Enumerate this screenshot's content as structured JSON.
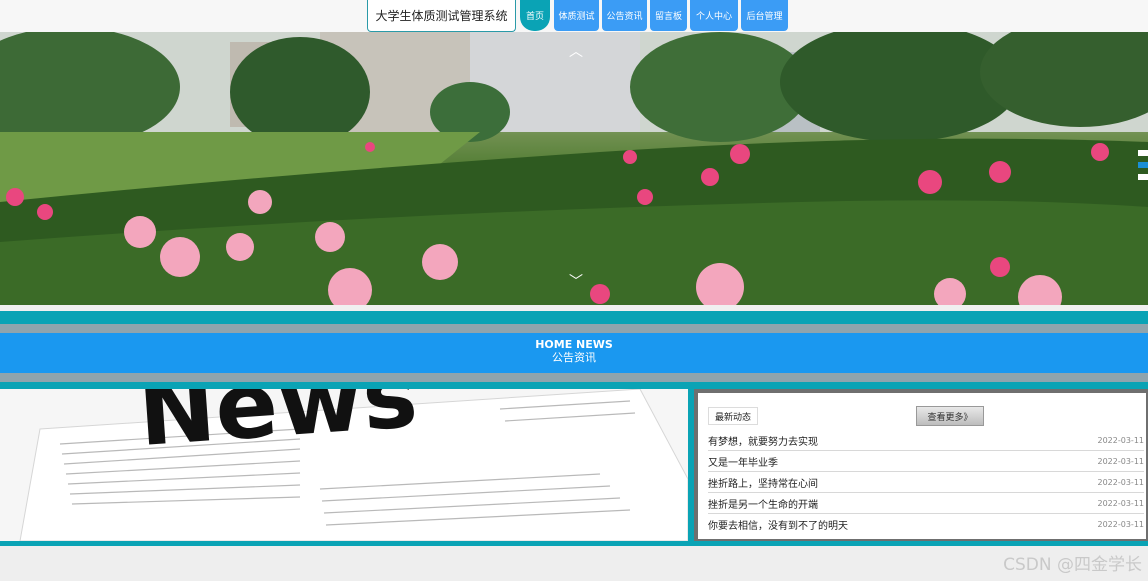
{
  "site": {
    "title": "大学生体质测试管理系统"
  },
  "nav": {
    "items": [
      {
        "label": "首页",
        "active": true
      },
      {
        "label": "体质测试",
        "active": false
      },
      {
        "label": "公告资讯",
        "active": false
      },
      {
        "label": "留言板",
        "active": false
      },
      {
        "label": "个人中心",
        "active": false
      },
      {
        "label": "后台管理",
        "active": false
      }
    ]
  },
  "banner": {
    "up_arrow": "︿",
    "down_arrow": "﹀",
    "dots_count": 3,
    "active_dot": 1
  },
  "news_section": {
    "heading_en": "HOME NEWS",
    "heading_cn": "公告资讯",
    "image_word": "News",
    "tab_label": "最新动态",
    "more_label": "查看更多》",
    "items": [
      {
        "title": "有梦想，就要努力去实现",
        "date": "2022-03-11"
      },
      {
        "title": "又是一年毕业季",
        "date": "2022-03-11"
      },
      {
        "title": "挫折路上，坚持常在心间",
        "date": "2022-03-11"
      },
      {
        "title": "挫折是另一个生命的开端",
        "date": "2022-03-11"
      },
      {
        "title": "你要去相信，没有到不了的明天",
        "date": "2022-03-11"
      }
    ]
  },
  "watermark": "CSDN @四金学长",
  "colors": {
    "nav_blue": "#3b9cf5",
    "nav_active": "#0aa3b5",
    "teal_band": "#0aa3b5",
    "grey_band": "#8fa4ad",
    "news_header": "#1a98f0"
  }
}
